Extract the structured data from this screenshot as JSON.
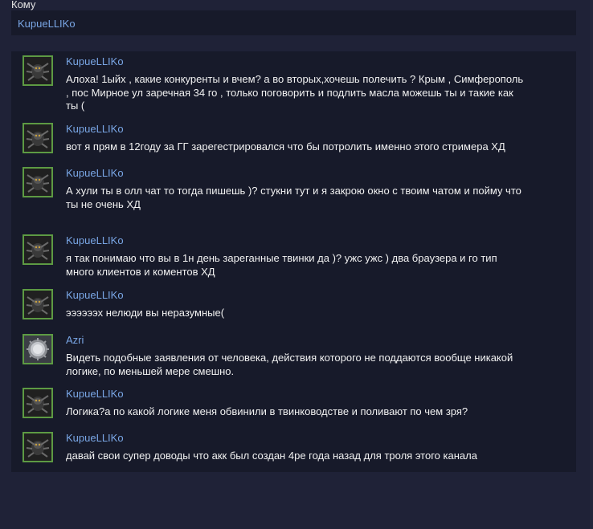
{
  "recipient": {
    "label": "Кому",
    "value": "KupueLLIKo"
  },
  "messages": [
    {
      "author": "KupueLLIKo",
      "avatar": "spider-avatar-icon",
      "text": "Алоха! 1ыйх , какие конкуренты и вчем? а во вторых,хочешь полечить ? Крым , Симферополь , пос Мирное ул заречная 34 го , только поговорить и подлить масла можешь ты и такие как ты ("
    },
    {
      "author": "KupueLLIKo",
      "avatar": "spider-avatar-icon",
      "text": "вот я прям в 12году за ГГ зарегестрировался что бы потролить именно этого стримера ХД"
    },
    {
      "author": "KupueLLIKo",
      "avatar": "spider-avatar-icon",
      "text": "А хули ты в олл чат то тогда пишешь )? стукни тут и я закрою окно с твоим чатом и пойму что ты не очень ХД"
    },
    {
      "author": "KupueLLIKo",
      "avatar": "spider-avatar-icon",
      "text": "я так понимаю что вы в 1н день зареганные твинки да )? ужс ужс ) два браузера и го тип много клиентов и коментов ХД"
    },
    {
      "author": "KupueLLIKo",
      "avatar": "spider-avatar-icon",
      "text": "ээээээх нелюди вы неразумные("
    },
    {
      "author": "Azri",
      "avatar": "silver-gear-avatar-icon",
      "text": "Видеть подобные заявления от человека, действия которого не поддаются вообще никакой логике, по меньшей мере смешно."
    },
    {
      "author": "KupueLLIKo",
      "avatar": "spider-avatar-icon",
      "text": "Логика?а по какой логике меня обвинили в твинководстве и поливают по чем зря?"
    },
    {
      "author": "KupueLLIKo",
      "avatar": "spider-avatar-icon",
      "text": "давай свои супер доводы что акк был создан 4ре года назад для троля этого канала"
    }
  ]
}
